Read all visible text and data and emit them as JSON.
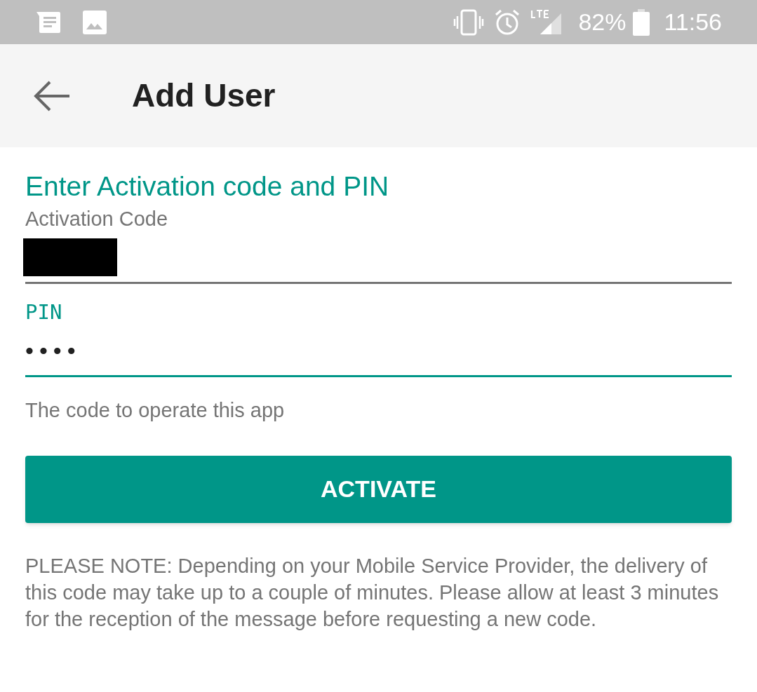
{
  "status_bar": {
    "battery": "82%",
    "time": "11:56"
  },
  "app_bar": {
    "title": "Add User"
  },
  "form": {
    "heading": "Enter Activation code and PIN",
    "fields": [
      {
        "label": "Activation Code",
        "redacted": true,
        "focused": false
      },
      {
        "label": "PIN",
        "value": "••••",
        "focused": true
      }
    ],
    "helper": "The code to operate this app",
    "button": "ACTIVATE",
    "note": "PLEASE NOTE: Depending on your Mobile Service Provider, the delivery of this code may take up to a couple of minutes. Please allow at least 3 minutes for the reception of the message before requesting a new code."
  }
}
